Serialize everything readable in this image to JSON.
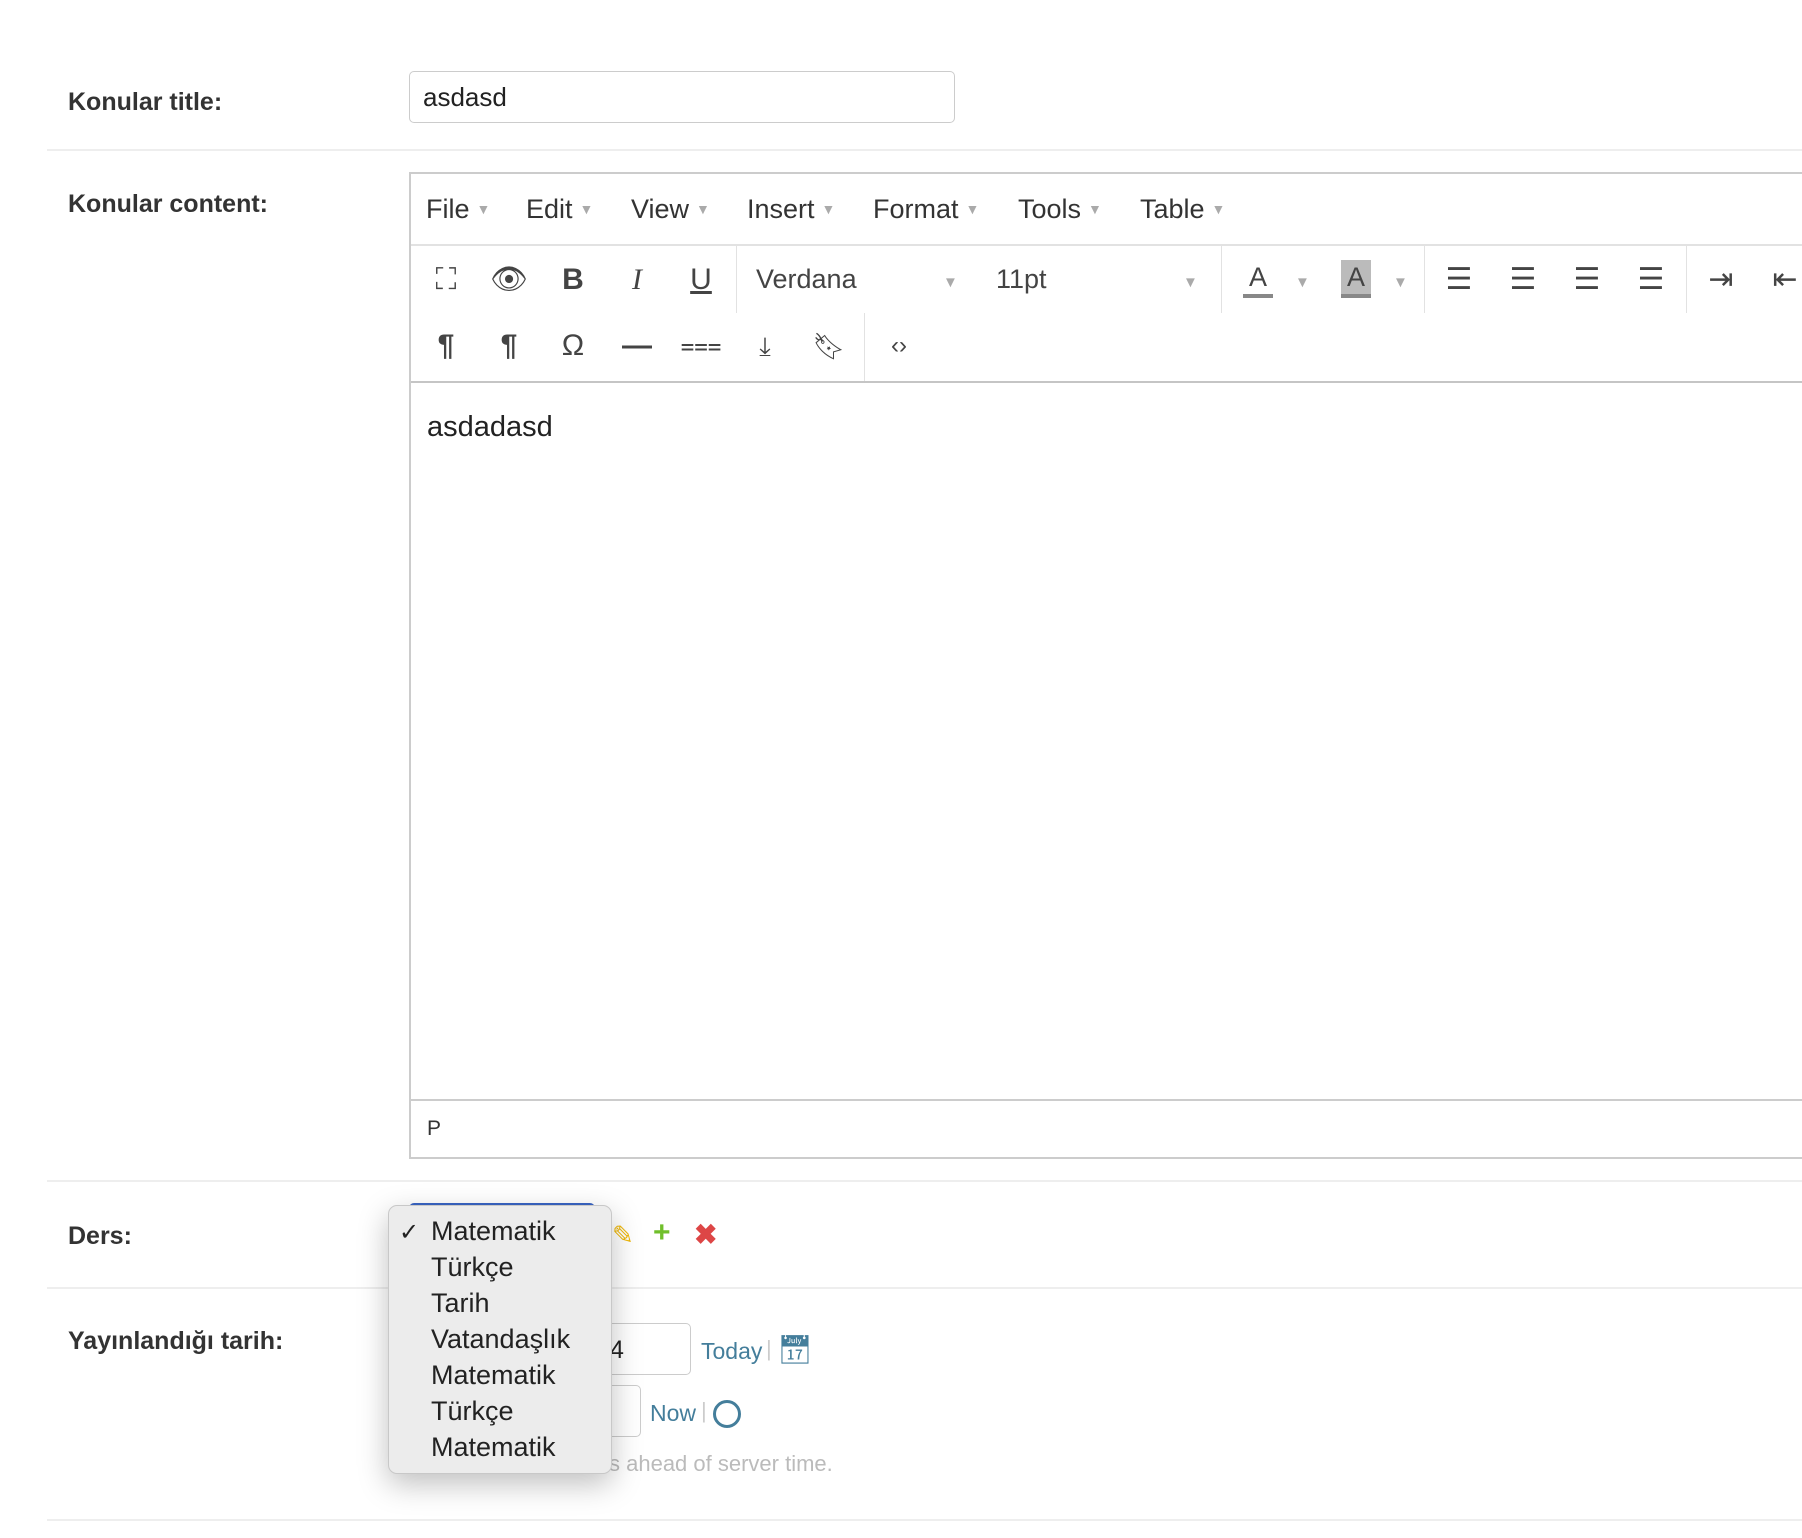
{
  "form": {
    "title_label": "Konular title:",
    "title_value": "asdasd",
    "content_label": "Konular content:",
    "ders_label": "Ders:",
    "date_label": "Yayınlandığı tarih:",
    "date_value_visible": "4",
    "today_link": "Today",
    "now_link": "Now",
    "help_text_visible": "s ahead of server time."
  },
  "editor": {
    "menus": [
      "File",
      "Edit",
      "View",
      "Insert",
      "Format",
      "Tools",
      "Table"
    ],
    "font_family": "Verdana",
    "font_size": "11pt",
    "text_color_glyph": "A",
    "bg_color_glyph": "A",
    "content": "asdadasd",
    "status_path": "P"
  },
  "ders_dropdown": {
    "options": [
      "Matematik",
      "Türkçe",
      "Tarih",
      "Vatandaşlık",
      "Matematik",
      "Türkçe",
      "Matematik"
    ],
    "selected_index": 0
  },
  "colors": {
    "link": "#447e9b",
    "add": "#70bf2b",
    "delete": "#dd4646",
    "edit": "#efb80b"
  }
}
